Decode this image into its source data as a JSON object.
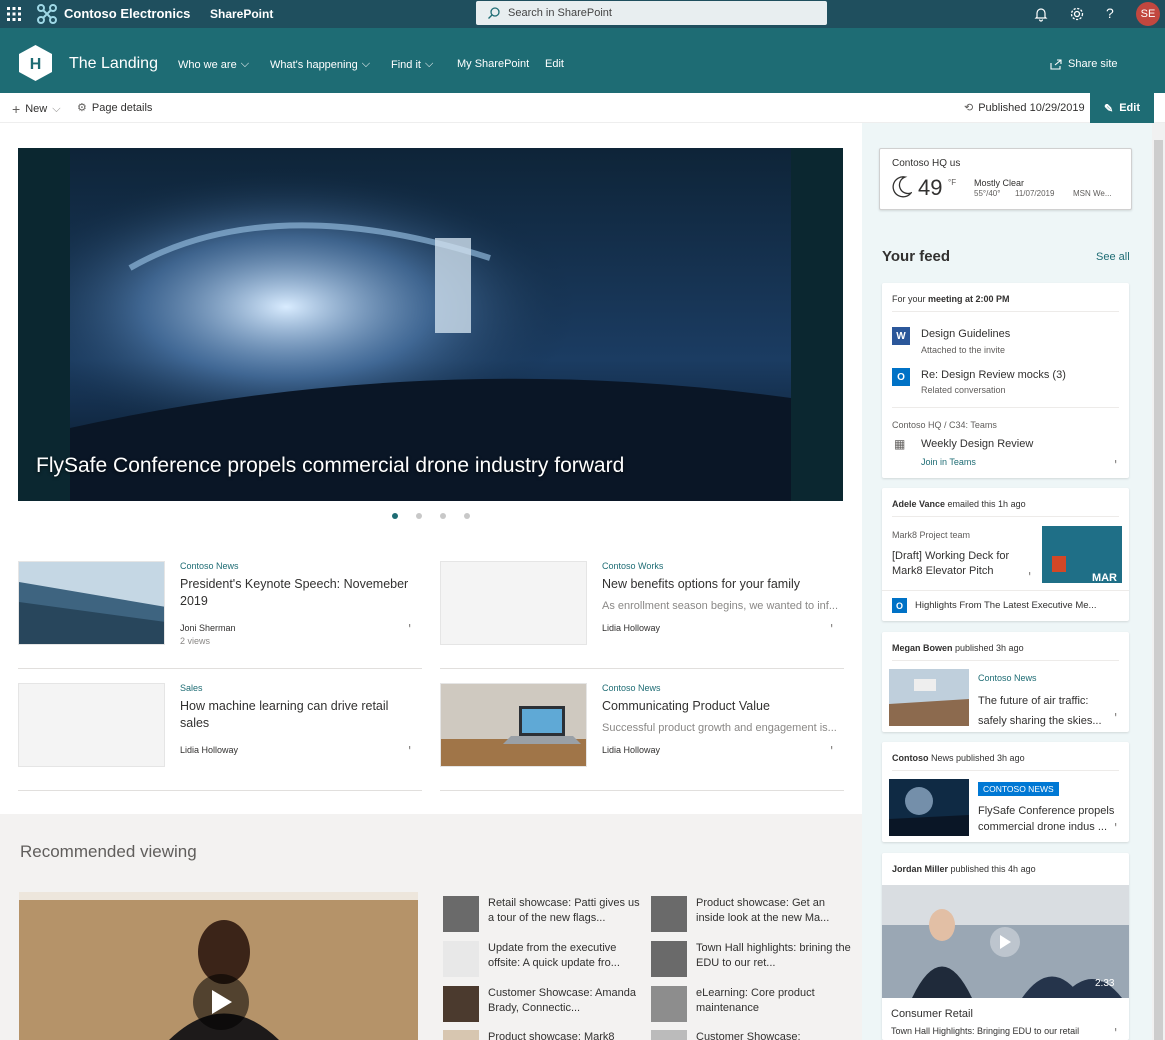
{
  "suite": {
    "company": "Contoso Electronics",
    "product": "SharePoint",
    "search_placeholder": "Search in SharePoint",
    "avatar_initials": "SE"
  },
  "site": {
    "title": "The Landing",
    "logo_letter": "H",
    "nav": [
      {
        "label": "Who we are",
        "dropdown": true
      },
      {
        "label": "What's happening",
        "dropdown": true
      },
      {
        "label": "Find it",
        "dropdown": true
      },
      {
        "label": "My SharePoint",
        "dropdown": false
      },
      {
        "label": "Edit",
        "dropdown": false
      }
    ],
    "share": "Share site"
  },
  "commandbar": {
    "new": "New",
    "page_details": "Page details",
    "published": "Published 10/29/2019",
    "edit": "Edit"
  },
  "hero": {
    "caption": "FlySafe Conference propels commercial drone industry forward",
    "dots": 4,
    "active_dot": 0
  },
  "news": [
    {
      "category": "Contoso News",
      "title": "President's Keynote Speech: Novemeber 2019",
      "desc": "",
      "author": "Joni Sherman",
      "views": "2 views"
    },
    {
      "category": "Contoso Works",
      "title": "New benefits options for your family",
      "desc": "As enrollment season begins, we wanted to inf...",
      "author": "Lidia Holloway",
      "views": ""
    },
    {
      "category": "Sales",
      "title": "How machine learning can drive retail sales",
      "desc": "",
      "author": "Lidia Holloway",
      "views": ""
    },
    {
      "category": "Contoso News",
      "title": "Communicating Product Value",
      "desc": "Successful product growth and engagement is...",
      "author": "Lidia Holloway",
      "views": ""
    }
  ],
  "recommended": {
    "title": "Recommended viewing",
    "items": [
      {
        "label": "Retail showcase: Patti gives us a tour of the new flags..."
      },
      {
        "label": "Product showcase: Get an inside look at the new Ma..."
      },
      {
        "label": "Update from the executive offsite: A quick update fro..."
      },
      {
        "label": "Town Hall highlights: brining the EDU to our ret..."
      },
      {
        "label": "Customer Showcase: Amanda Brady, Connectic..."
      },
      {
        "label": "eLearning: Core product maintenance"
      },
      {
        "label": "Product showcase: Mark8"
      },
      {
        "label": "Customer Showcase:"
      }
    ]
  },
  "weather": {
    "location": "Contoso HQ us",
    "temp": "49",
    "unit": "°F",
    "condition": "Mostly Clear",
    "range": "55°/40°",
    "date": "11/07/2019",
    "source": "MSN We..."
  },
  "feed": {
    "title": "Your feed",
    "see_all": "See all",
    "meeting": {
      "header_pre": "For your ",
      "header_bold": "meeting at 2:00 PM",
      "doc1_title": "Design Guidelines",
      "doc1_sub": "Attached to the invite",
      "doc2_title": "Re: Design Review mocks (3)",
      "doc2_sub": "Related conversation",
      "location": "Contoso HQ / C34: Teams",
      "event": "Weekly Design Review",
      "join": "Join in Teams"
    },
    "email": {
      "who": "Adele Vance",
      "action": " emailed this 1h ago",
      "team": "Mark8 Project team",
      "title": "[Draft] Working Deck for Mark8 Elevator Pitch",
      "highlight": "Highlights From The Latest Executive Me..."
    },
    "post1": {
      "who": "Megan Bowen",
      "action": " published 3h ago",
      "cat": "Contoso News",
      "title": "The future of air traffic: safely sharing the skies..."
    },
    "post2": {
      "who": "Contoso",
      "who2": " News",
      "action": " published 3h ago",
      "cat": "CONTOSO NEWS",
      "title": "FlySafe Conference propels commercial drone indus ..."
    },
    "video": {
      "who": "Jordan Miller",
      "action": " published this 4h ago",
      "duration": "2:33",
      "title": "Consumer Retail",
      "sub": "Town Hall Highlights: Bringing EDU to our retail"
    }
  },
  "colors": {
    "suite": "#1f4f5e",
    "theme": "#1e6c74",
    "rail": "#eef6f7"
  }
}
